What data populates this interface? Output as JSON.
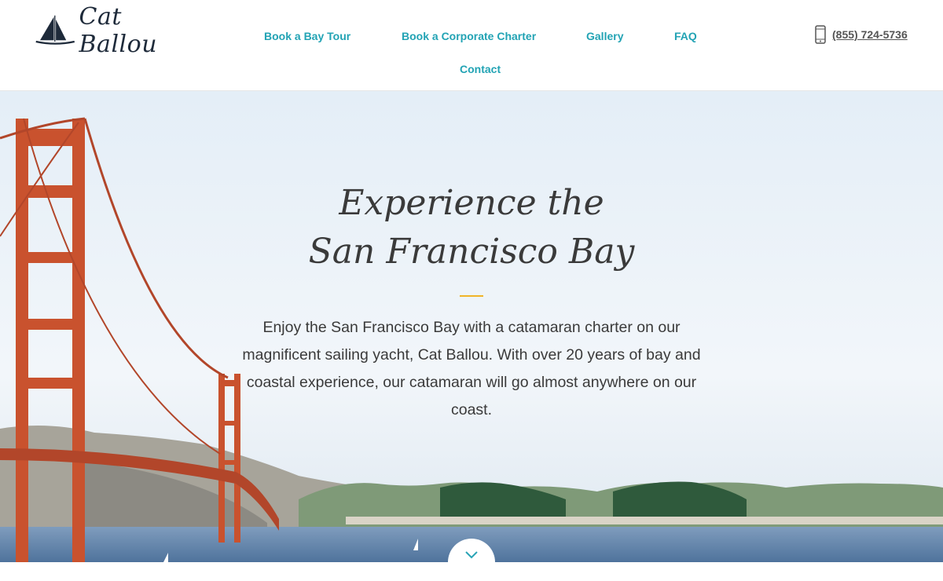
{
  "brand": {
    "name": "Cat Ballou",
    "logo_icon": "sailboat-icon"
  },
  "nav": {
    "items": [
      {
        "label": "Book a Bay Tour"
      },
      {
        "label": "Book a Corporate Charter"
      },
      {
        "label": "Gallery"
      },
      {
        "label": "FAQ"
      },
      {
        "label": "Contact"
      }
    ]
  },
  "phone": {
    "icon": "mobile-phone-icon",
    "number": "(855) 724-5736"
  },
  "hero": {
    "title_line1": "Experience the",
    "title_line2": "San Francisco Bay",
    "body": "Enjoy the San Francisco Bay with a catamaran charter on our magnificent sailing yacht, Cat Ballou. With over 20 years of bay and coastal experience, our catamaran will go almost anywhere on our coast.",
    "scroll_icon": "chevron-down-icon"
  },
  "colors": {
    "nav_link": "#22a3b4",
    "accent_divider": "#f0b428",
    "text": "#3a3a3a",
    "bridge": "#c9522e",
    "water": "#5c7fa6"
  }
}
